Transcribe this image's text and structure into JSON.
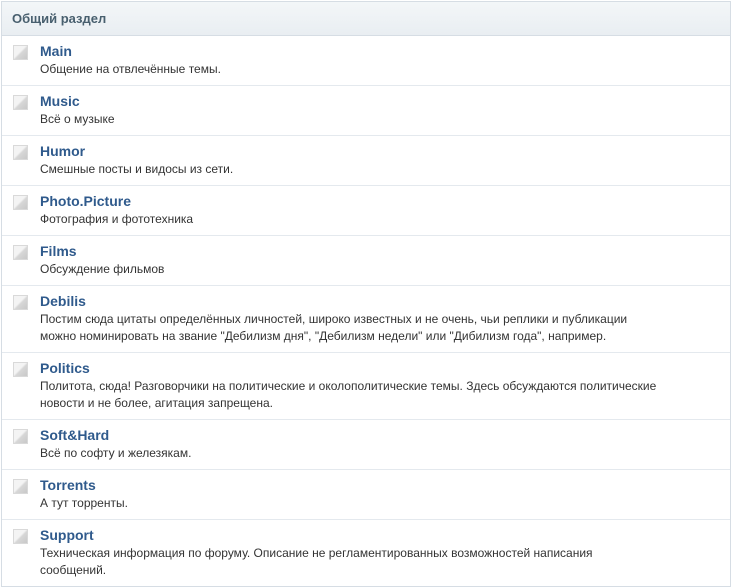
{
  "section": {
    "title": "Общий раздел"
  },
  "forums": [
    {
      "title": "Main",
      "description": "Общение на отвлечённые темы."
    },
    {
      "title": "Music",
      "description": "Всё о музыке"
    },
    {
      "title": "Humor",
      "description": "Смешные посты и видосы из сети."
    },
    {
      "title": "Photo.Picture",
      "description": "Фотография и фототехника"
    },
    {
      "title": "Films",
      "description": "Обсуждение фильмов"
    },
    {
      "title": "Debilis",
      "description": "Постим сюда цитаты определённых личностей, широко известных и не очень, чьи реплики и публикации можно номинировать на звание \"Дебилизм дня\", \"Дебилизм недели\" или \"Дибилизм года\", например."
    },
    {
      "title": "Politics",
      "description": "Политота, сюда! Разговорчики на политические и околополитические темы. Здесь обсуждаются политические новости и не более, агитация запрещена."
    },
    {
      "title": "Soft&Hard",
      "description": "Всё по софту и железякам."
    },
    {
      "title": "Torrents",
      "description": "А тут торренты."
    },
    {
      "title": "Support",
      "description": "Техническая информация по форуму. Описание не регламентированных возможностей написания сообщений."
    }
  ],
  "icons": {
    "forum_status": "forum-read-icon"
  },
  "colors": {
    "header_text": "#485f6e",
    "forum_title": "#2f5a8c",
    "description_text": "#333333",
    "border": "#d6dde4"
  }
}
